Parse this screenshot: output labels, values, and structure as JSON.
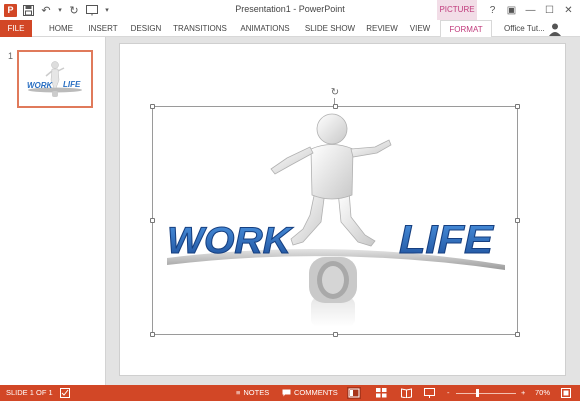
{
  "window": {
    "title": "Presentation1 - PowerPoint",
    "context_tab": "PICTURE ...",
    "help_glyph": "?",
    "controls": [
      "?",
      "▣",
      "—",
      "☐",
      "✕"
    ]
  },
  "qat": {
    "app_logo": "P",
    "icons": [
      "save-icon",
      "undo-icon",
      "redo-icon",
      "start-from-beginning-icon"
    ]
  },
  "ribbon": {
    "file_label": "FILE",
    "tabs": [
      "HOME",
      "INSERT",
      "DESIGN",
      "TRANSITIONS",
      "ANIMATIONS",
      "SLIDE SHOW",
      "REVIEW",
      "VIEW",
      "FORMAT"
    ],
    "account": "Office Tut..."
  },
  "thumbnail_pane": {
    "slide_number": "1",
    "thumb_text_left": "WORK",
    "thumb_text_right": "LIFE"
  },
  "slide": {
    "word_left": "WORK",
    "word_right": "LIFE",
    "accent_color": "#2a6fc2"
  },
  "statusbar": {
    "slide_info": "SLIDE 1 OF 1",
    "notes": "NOTES",
    "comments": "COMMENTS",
    "zoom": "70%",
    "zoom_minus": "-",
    "zoom_plus": "+",
    "color": "#d24726"
  }
}
